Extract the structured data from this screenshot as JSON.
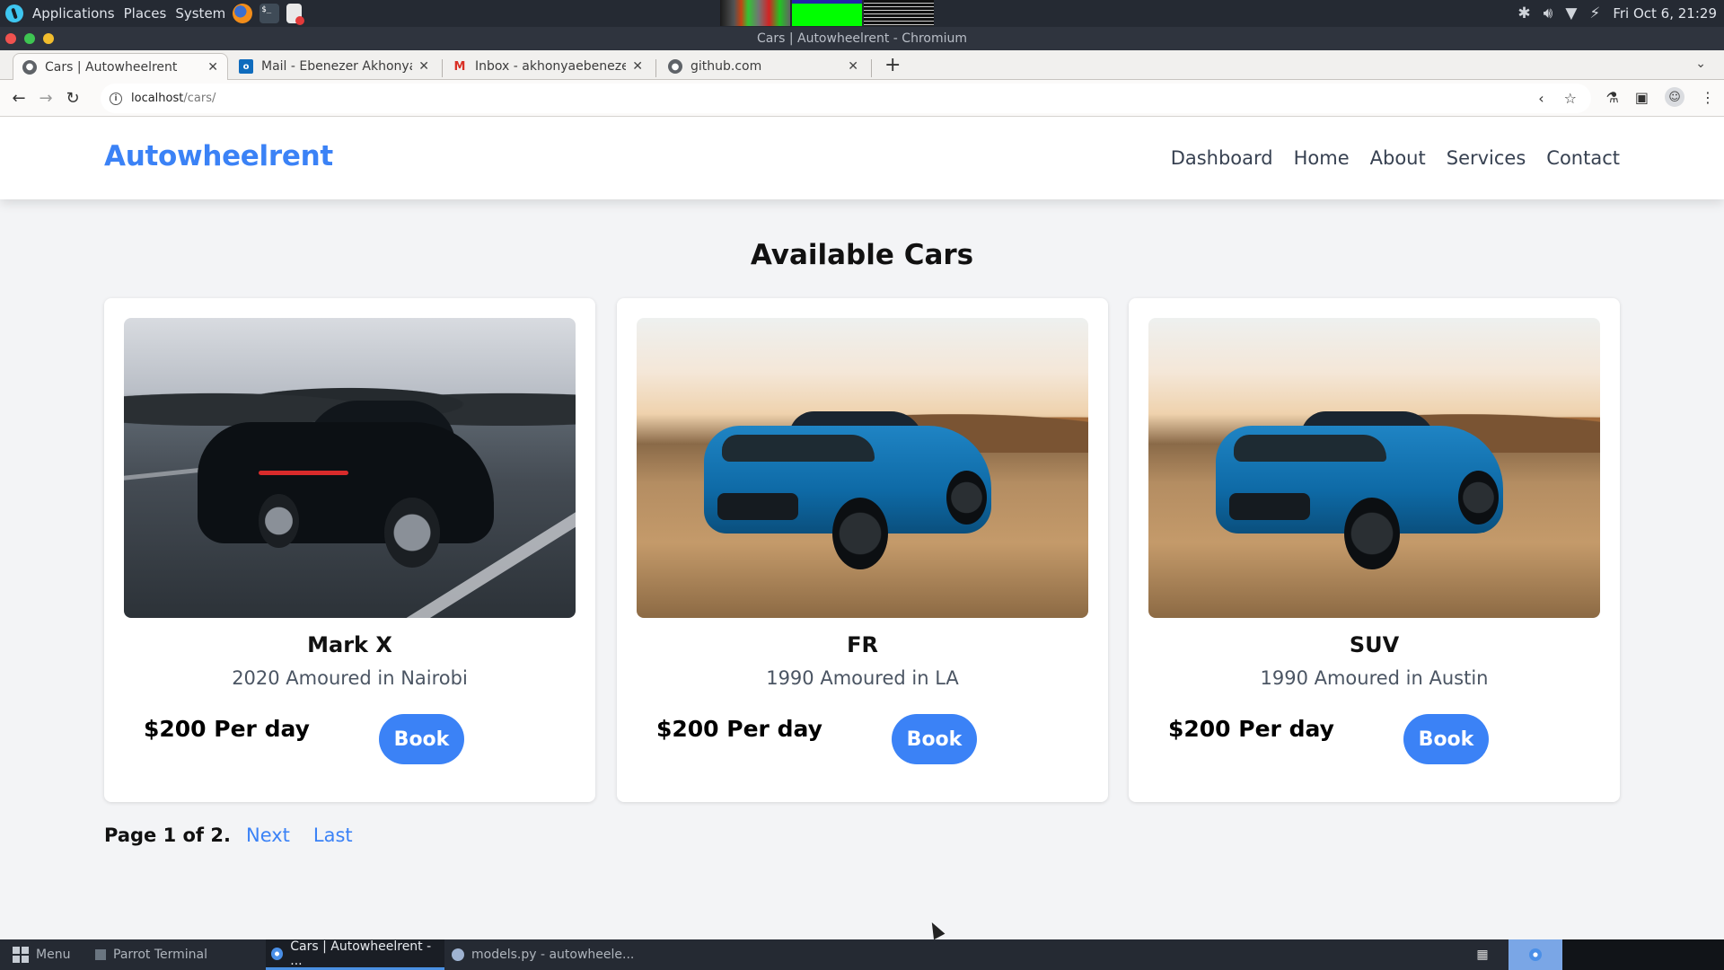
{
  "os_panel": {
    "menus": [
      "Applications",
      "Places",
      "System"
    ],
    "clock": "Fri Oct  6, 21:29"
  },
  "window": {
    "title": "Cars | Autowheelrent - Chromium"
  },
  "tabs": [
    {
      "title": "Cars | Autowheelrent",
      "icon": "globe-icon",
      "active": true
    },
    {
      "title": "Mail - Ebenezer Akhonya",
      "icon": "outlook-icon",
      "active": false
    },
    {
      "title": "Inbox - akhonyaebenezer",
      "icon": "gmail-icon",
      "active": false
    },
    {
      "title": "github.com",
      "icon": "globe-icon",
      "active": false
    }
  ],
  "address_bar": {
    "host": "localhost",
    "path": "/cars/"
  },
  "site": {
    "brand": "Autowheelrent",
    "brand_color": "#3b82f6",
    "nav": [
      "Dashboard",
      "Home",
      "About",
      "Services",
      "Contact"
    ]
  },
  "main": {
    "heading": "Available Cars",
    "cars": [
      {
        "name": "Mark X",
        "description": "2020 Amoured in Nairobi",
        "price": "$200 Per day",
        "book_label": "Book",
        "photo": "black sedan on highway"
      },
      {
        "name": "FR",
        "description": "1990 Amoured in LA",
        "price": "$200 Per day",
        "book_label": "Book",
        "photo": "blue sports car in desert"
      },
      {
        "name": "SUV",
        "description": "1990 Amoured in Austin",
        "price": "$200 Per day",
        "book_label": "Book",
        "photo": "blue sports car in desert"
      }
    ],
    "pagination": {
      "info": "Page 1 of 2.",
      "next": "Next",
      "last": "Last"
    }
  },
  "taskbar": {
    "items": [
      {
        "label": "Menu"
      },
      {
        "label": "Parrot Terminal"
      },
      {
        "label": "Cars | Autowheelrent - ...",
        "active": true
      },
      {
        "label": "models.py - autowheele..."
      }
    ]
  }
}
